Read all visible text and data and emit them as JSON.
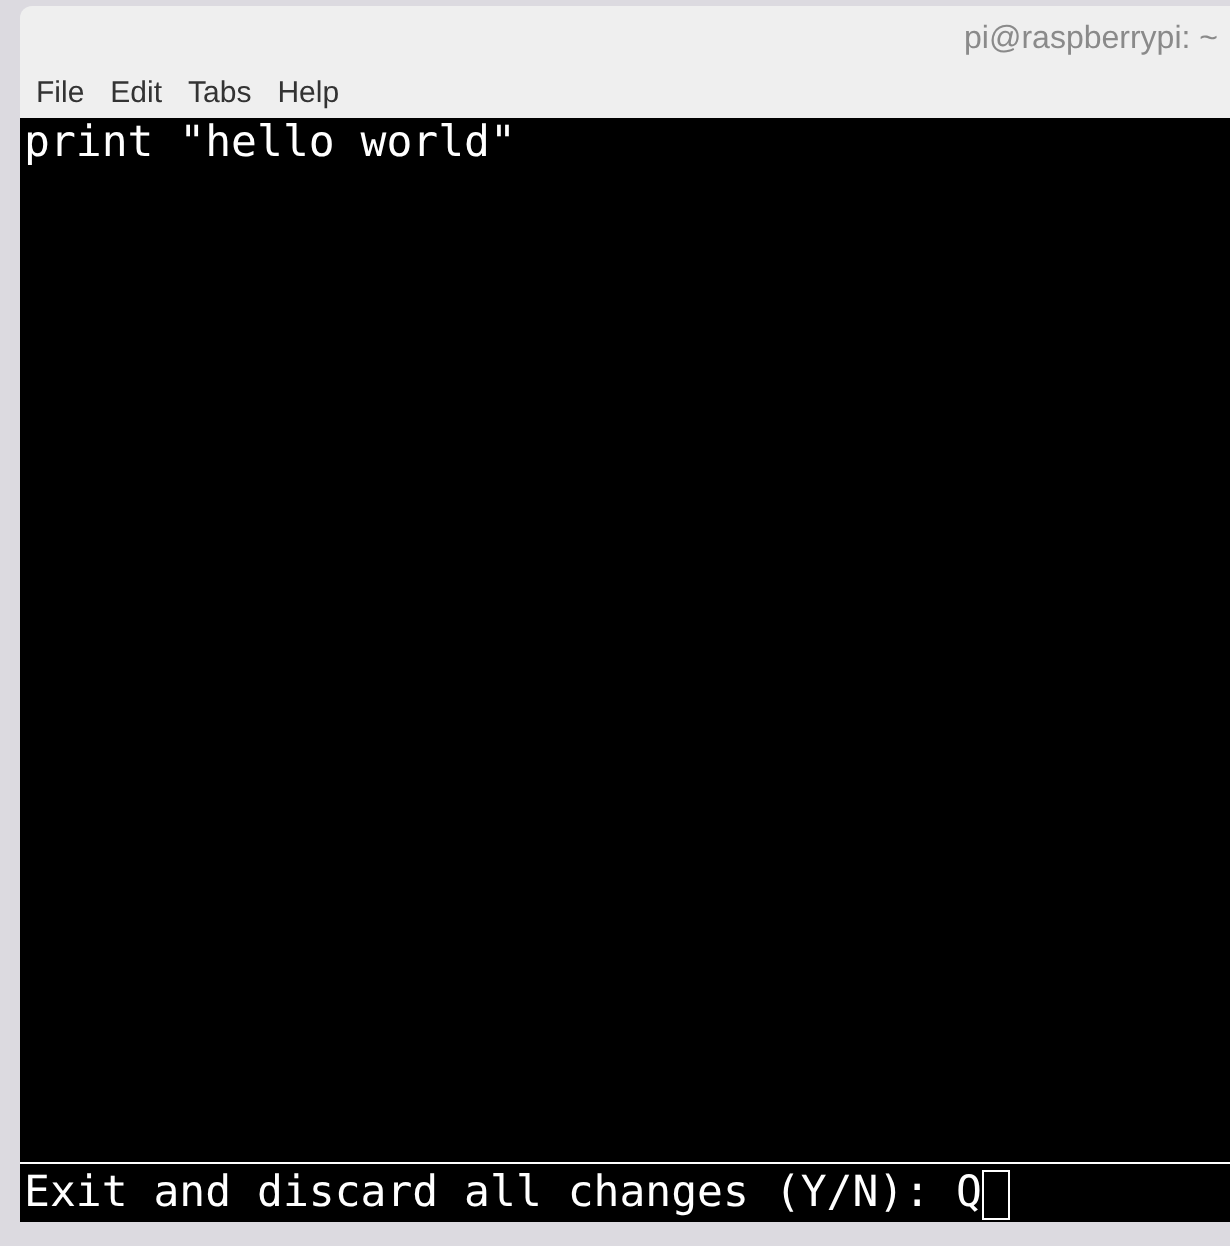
{
  "window": {
    "title": "pi@raspberrypi: ~"
  },
  "menu": [
    "File",
    "Edit",
    "Tabs",
    "Help"
  ],
  "terminal": {
    "lines": [
      "print \"hello world\""
    ],
    "prompt": {
      "text": "Exit and discard all changes (Y/N):",
      "value": "Q",
      "cursor": true
    }
  }
}
